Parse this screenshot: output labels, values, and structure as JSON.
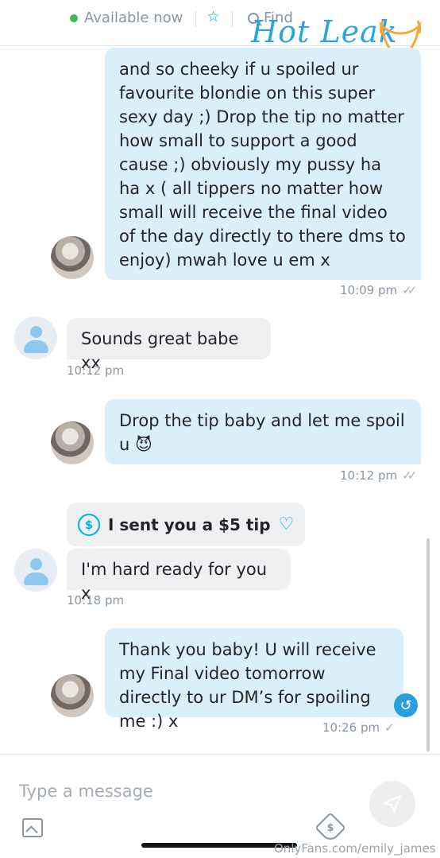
{
  "header": {
    "status": "Available now",
    "find": "Find",
    "watermark": "Hot Leak"
  },
  "messages": [
    {
      "text": "and so cheeky if u spoiled ur favourite blondie on this super sexy day ;) Drop the tip no matter how small to support a good cause ;) obviously my pussy ha ha x ( all tippers no matter how small will receive the final video of the day directly to there dms to enjoy) mwah love u em x",
      "time": "10:09 pm"
    },
    {
      "text": "Sounds great babe xx",
      "time": "10:12 pm"
    },
    {
      "text": "Drop the tip baby and let me spoil u 😈",
      "time": "10:12 pm"
    },
    {
      "tip": "I sent you a $5 tip",
      "text": "I'm hard ready for you x",
      "time": "10:18 pm"
    },
    {
      "text": "Thank you baby! U will receive my Final video tomorrow directly to ur DM’s for spoiling me :) x",
      "time": "10:26 pm"
    }
  ],
  "composer": {
    "placeholder": "Type a message"
  },
  "footer": {
    "source": "OnlyFans.com/emily_james"
  },
  "icons": [
    "star-icon",
    "search-icon",
    "dollar-icon",
    "heart-icon",
    "reply-icon",
    "image-icon",
    "price-tag-icon",
    "send-icon"
  ],
  "colors": {
    "accent": "#00aff0",
    "outgoing_bubble": "#d9effc",
    "incoming_bubble": "#eef0f2",
    "online": "#3fb950"
  }
}
